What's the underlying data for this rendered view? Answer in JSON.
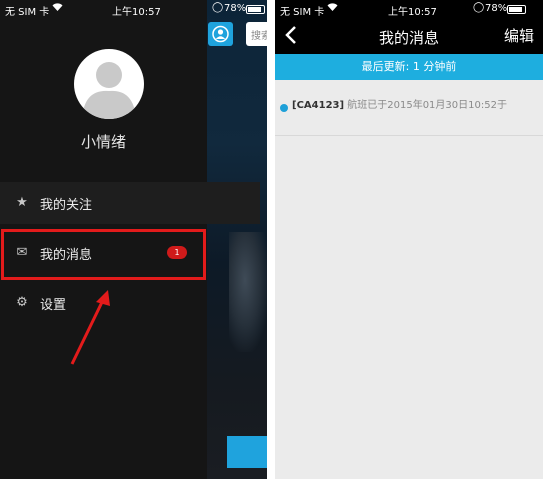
{
  "status_bar": {
    "carrier": "无 SIM 卡",
    "time": "上午10:57",
    "battery": "78%"
  },
  "left": {
    "search_placeholder": "搜索",
    "username": "小情绪",
    "menu": [
      {
        "label": "我的关注",
        "icon": "star-icon"
      },
      {
        "label": "我的消息",
        "icon": "mail-icon",
        "badge": "1"
      },
      {
        "label": "设置",
        "icon": "gear-icon"
      }
    ],
    "colors": {
      "accent": "#1fa3dd",
      "highlight": "#e31b1b",
      "badge": "#cf1a1a"
    }
  },
  "right": {
    "title": "我的消息",
    "edit_label": "编辑",
    "update_text": "最后更新: 1 分钟前",
    "message": {
      "code": "[CA4123]",
      "text": " 航班已于2015年01月30日10:52于"
    },
    "colors": {
      "update_bar": "#1eaedf",
      "unread_dot": "#1ea0d8"
    }
  }
}
